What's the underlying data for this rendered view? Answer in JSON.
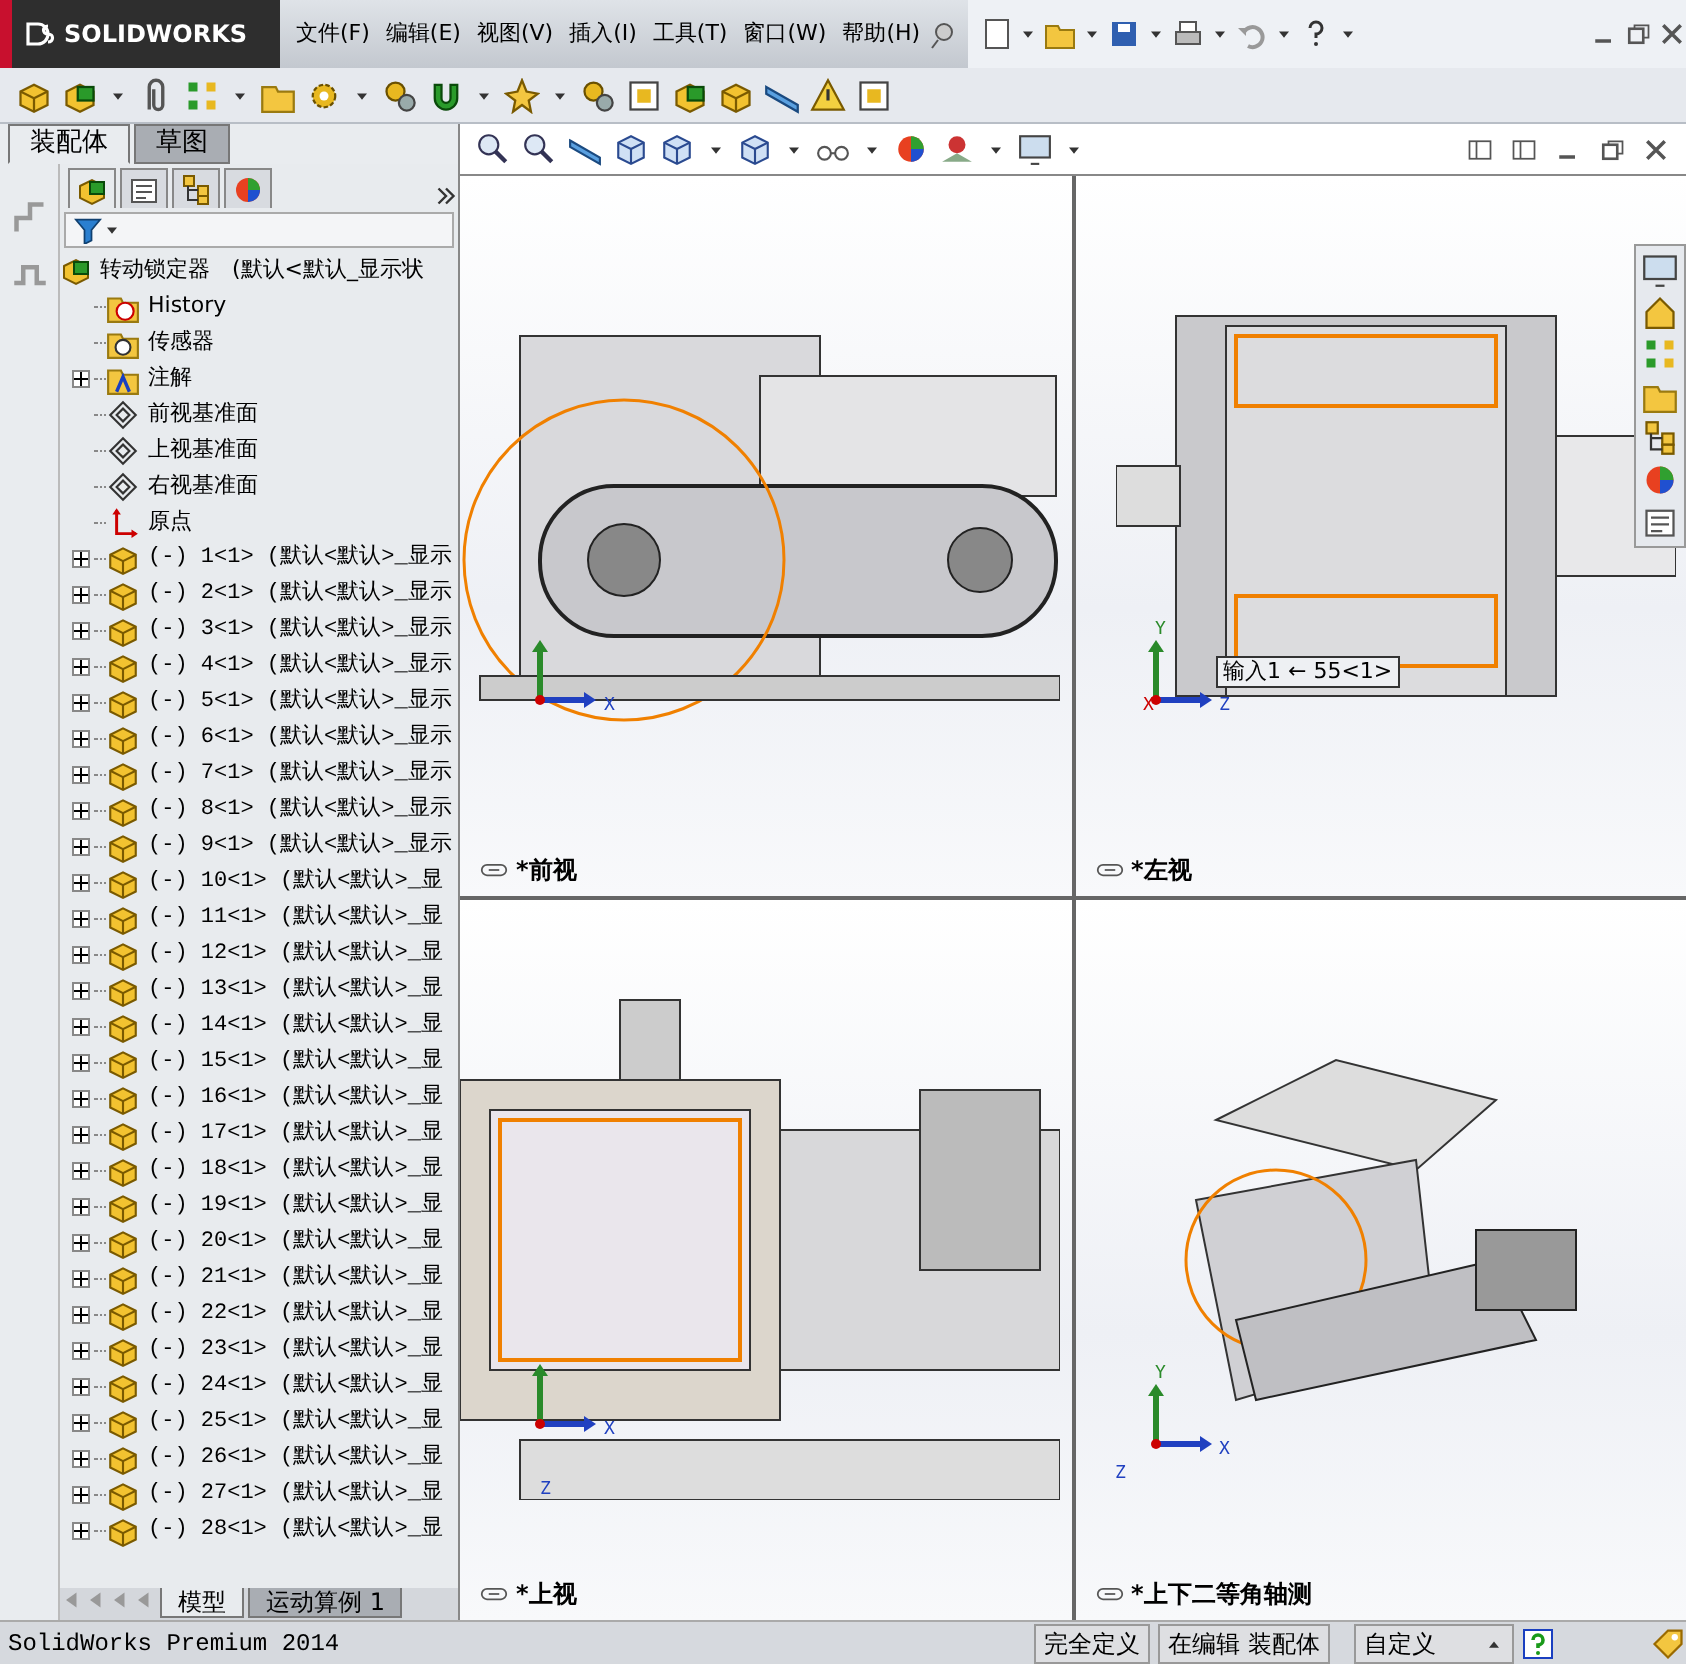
{
  "app": {
    "logo": "SOLIDWORKS",
    "menu": [
      "文件(F)",
      "编辑(E)",
      "视图(V)",
      "插入(I)",
      "工具(T)",
      "窗口(W)",
      "帮助(H)"
    ]
  },
  "panel_tabs": [
    {
      "label": "装配体",
      "selected": true
    },
    {
      "label": "草图",
      "selected": false
    }
  ],
  "tree": {
    "root": "转动锁定器　(默认<默认_显示状",
    "items": [
      {
        "kind": "history",
        "label": "History",
        "expandable": false
      },
      {
        "kind": "sensors",
        "label": "传感器",
        "expandable": false
      },
      {
        "kind": "annotations",
        "label": "注解",
        "expandable": true
      },
      {
        "kind": "plane",
        "label": "前视基准面",
        "expandable": false
      },
      {
        "kind": "plane",
        "label": "上视基准面",
        "expandable": false
      },
      {
        "kind": "plane",
        "label": "右视基准面",
        "expandable": false
      },
      {
        "kind": "origin",
        "label": "原点",
        "expandable": false
      },
      {
        "kind": "component",
        "label": "(-) 1<1> (默认<默认>_显示",
        "expandable": true
      },
      {
        "kind": "component",
        "label": "(-) 2<1> (默认<默认>_显示",
        "expandable": true
      },
      {
        "kind": "component",
        "label": "(-) 3<1> (默认<默认>_显示",
        "expandable": true
      },
      {
        "kind": "component",
        "label": "(-) 4<1> (默认<默认>_显示",
        "expandable": true
      },
      {
        "kind": "component",
        "label": "(-) 5<1> (默认<默认>_显示",
        "expandable": true
      },
      {
        "kind": "component",
        "label": "(-) 6<1> (默认<默认>_显示",
        "expandable": true
      },
      {
        "kind": "component",
        "label": "(-) 7<1> (默认<默认>_显示",
        "expandable": true
      },
      {
        "kind": "component",
        "label": "(-) 8<1> (默认<默认>_显示",
        "expandable": true
      },
      {
        "kind": "component",
        "label": "(-) 9<1> (默认<默认>_显示",
        "expandable": true
      },
      {
        "kind": "component",
        "label": "(-) 10<1> (默认<默认>_显",
        "expandable": true
      },
      {
        "kind": "component",
        "label": "(-) 11<1> (默认<默认>_显",
        "expandable": true
      },
      {
        "kind": "component",
        "label": "(-) 12<1> (默认<默认>_显",
        "expandable": true
      },
      {
        "kind": "component",
        "label": "(-) 13<1> (默认<默认>_显",
        "expandable": true
      },
      {
        "kind": "component",
        "label": "(-) 14<1> (默认<默认>_显",
        "expandable": true
      },
      {
        "kind": "component",
        "label": "(-) 15<1> (默认<默认>_显",
        "expandable": true
      },
      {
        "kind": "component",
        "label": "(-) 16<1> (默认<默认>_显",
        "expandable": true
      },
      {
        "kind": "component",
        "label": "(-) 17<1> (默认<默认>_显",
        "expandable": true
      },
      {
        "kind": "component",
        "label": "(-) 18<1> (默认<默认>_显",
        "expandable": true
      },
      {
        "kind": "component",
        "label": "(-) 19<1> (默认<默认>_显",
        "expandable": true
      },
      {
        "kind": "component",
        "label": "(-) 20<1> (默认<默认>_显",
        "expandable": true
      },
      {
        "kind": "component",
        "label": "(-) 21<1> (默认<默认>_显",
        "expandable": true
      },
      {
        "kind": "component",
        "label": "(-) 22<1> (默认<默认>_显",
        "expandable": true
      },
      {
        "kind": "component",
        "label": "(-) 23<1> (默认<默认>_显",
        "expandable": true
      },
      {
        "kind": "component",
        "label": "(-) 24<1> (默认<默认>_显",
        "expandable": true
      },
      {
        "kind": "component",
        "label": "(-) 25<1> (默认<默认>_显",
        "expandable": true
      },
      {
        "kind": "component",
        "label": "(-) 26<1> (默认<默认>_显",
        "expandable": true
      },
      {
        "kind": "component",
        "label": "(-) 27<1> (默认<默认>_显",
        "expandable": true
      },
      {
        "kind": "component",
        "label": "(-) 28<1> (默认<默认>_显",
        "expandable": true
      }
    ]
  },
  "manager_tabs": [
    {
      "selected": true
    },
    {
      "selected": false
    },
    {
      "selected": false
    },
    {
      "selected": false
    }
  ],
  "bottom_tabs": [
    {
      "label": "模型",
      "selected": true
    },
    {
      "label": "运动算例 1",
      "selected": false
    }
  ],
  "viewports": [
    {
      "kind": "front",
      "label": "*前视",
      "axes": [
        "X"
      ]
    },
    {
      "kind": "left",
      "label": "*左视",
      "tooltip": "输入1 ← 55<1>",
      "axes": [
        "Y",
        "X",
        "Z"
      ]
    },
    {
      "kind": "top",
      "label": "*上视",
      "axes": [
        "X",
        "Z"
      ]
    },
    {
      "kind": "iso",
      "label": "*上下二等角轴测",
      "axes": [
        "Y",
        "Z",
        "X"
      ]
    }
  ],
  "status_bar": {
    "product": "SolidWorks Premium 2014",
    "fields": [
      "完全定义",
      "在编辑 装配体"
    ],
    "units": "自定义"
  }
}
